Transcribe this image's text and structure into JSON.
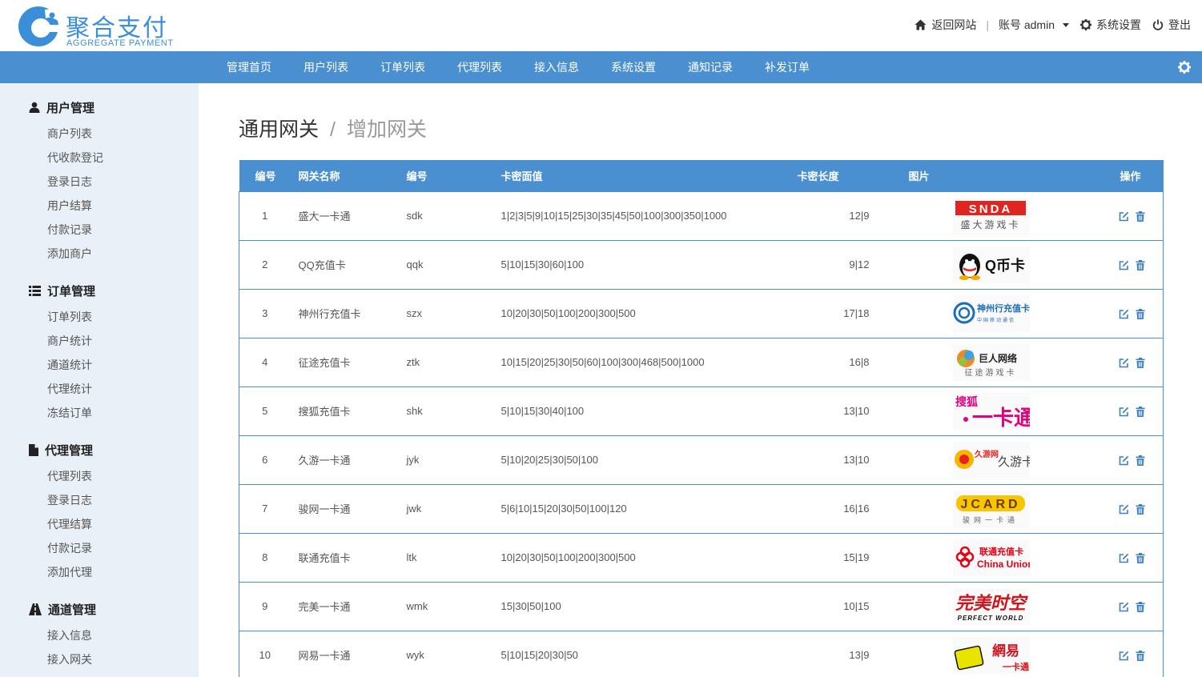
{
  "brand": {
    "title": "聚合支付",
    "subtitle": "AGGREGATE PAYMENT",
    "color": "#3b8fd9"
  },
  "topnav": {
    "back_site": "返回网站",
    "account": "账号 admin",
    "settings": "系统设置",
    "logout": "登出",
    "separator": "|"
  },
  "navbar": {
    "color": "#4a8fd0",
    "items": [
      "管理首页",
      "用户列表",
      "订单列表",
      "代理列表",
      "接入信息",
      "系统设置",
      "通知记录",
      "补发订单"
    ]
  },
  "sidebar": {
    "groups": [
      {
        "title": "用户管理",
        "icon": "user-icon",
        "items": [
          "商户列表",
          "代收款登记",
          "登录日志",
          "用户结算",
          "付款记录",
          "添加商户"
        ]
      },
      {
        "title": "订单管理",
        "icon": "list-icon",
        "items": [
          "订单列表",
          "商户统计",
          "通道统计",
          "代理统计",
          "冻结订单"
        ]
      },
      {
        "title": "代理管理",
        "icon": "file-icon",
        "items": [
          "代理列表",
          "登录日志",
          "代理结算",
          "付款记录",
          "添加代理"
        ]
      },
      {
        "title": "通道管理",
        "icon": "road-icon",
        "items": [
          "接入信息",
          "接入网关"
        ]
      }
    ]
  },
  "breadcrumb": {
    "parent": "通用网关",
    "separator": "/",
    "current": "增加网关"
  },
  "table": {
    "headers": [
      "编号",
      "网关名称",
      "编号",
      "卡密面值",
      "卡密长度",
      "图片",
      "操作"
    ],
    "rows": [
      {
        "id": "1",
        "name": "盛大一卡通",
        "code": "sdk",
        "values": "1|2|3|5|9|10|15|25|30|35|45|50|100|300|350|1000",
        "length": "12|9",
        "logo": {
          "kind": "snda",
          "text": "SNDA",
          "sub": "盛大游戏卡"
        }
      },
      {
        "id": "2",
        "name": "QQ充值卡",
        "code": "qqk",
        "values": "5|10|15|30|60|100",
        "length": "9|12",
        "logo": {
          "kind": "qq",
          "text": "Q币卡"
        }
      },
      {
        "id": "3",
        "name": "神州行充值卡",
        "code": "szx",
        "values": "10|20|30|50|100|200|300|500",
        "length": "17|18",
        "logo": {
          "kind": "szx",
          "text": "神州行充值卡",
          "sub": "中国移动通信"
        }
      },
      {
        "id": "4",
        "name": "征途充值卡",
        "code": "ztk",
        "values": "10|15|20|25|30|50|60|100|300|468|500|1000",
        "length": "16|8",
        "logo": {
          "kind": "giant",
          "text": "巨人网络",
          "sub": "征途游戏卡"
        }
      },
      {
        "id": "5",
        "name": "搜狐充值卡",
        "code": "shk",
        "values": "5|10|15|30|40|100",
        "length": "13|10",
        "logo": {
          "kind": "sohu",
          "text": "搜狐",
          "sub": "一卡通"
        }
      },
      {
        "id": "6",
        "name": "久游一卡通",
        "code": "jyk",
        "values": "5|10|20|25|30|50|100",
        "length": "13|10",
        "logo": {
          "kind": "9you",
          "text": "久游卡",
          "sub": "久游网"
        }
      },
      {
        "id": "7",
        "name": "骏网一卡通",
        "code": "jwk",
        "values": "5|6|10|15|20|30|50|100|120",
        "length": "16|16",
        "logo": {
          "kind": "jcard",
          "text": "JCARD",
          "sub": "骏网一卡通"
        }
      },
      {
        "id": "8",
        "name": "联通充值卡",
        "code": "ltk",
        "values": "10|20|30|50|100|200|300|500",
        "length": "15|19",
        "logo": {
          "kind": "unicom",
          "text": "联通充值卡",
          "sub": "China Union"
        }
      },
      {
        "id": "9",
        "name": "完美一卡通",
        "code": "wmk",
        "values": "15|30|50|100",
        "length": "10|15",
        "logo": {
          "kind": "wanmei",
          "text": "完美时空",
          "sub": "PERFECT WORLD"
        }
      },
      {
        "id": "10",
        "name": "网易一卡通",
        "code": "wyk",
        "values": "5|10|15|20|30|50",
        "length": "13|9",
        "logo": {
          "kind": "netease",
          "text": "網易",
          "sub": "一卡通"
        }
      }
    ]
  }
}
